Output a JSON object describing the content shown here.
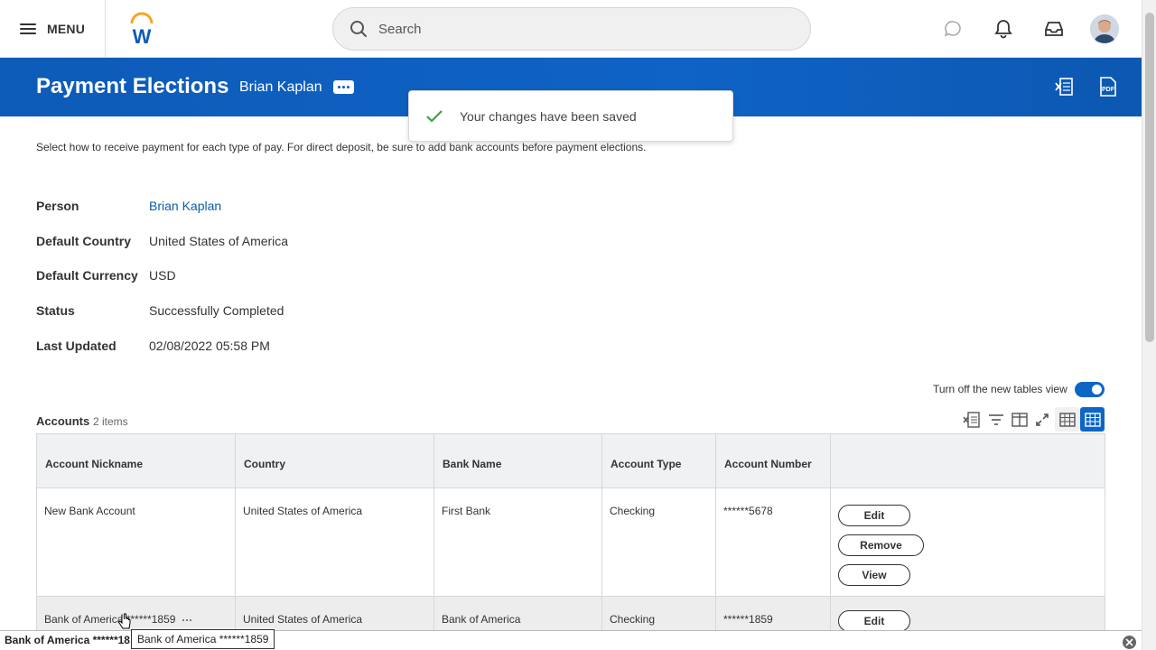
{
  "topbar": {
    "menu_label": "MENU",
    "search_placeholder": "Search"
  },
  "header": {
    "title": "Payment Elections",
    "worker": "Brian Kaplan"
  },
  "toast": {
    "message": "Your changes have been saved"
  },
  "instructions": "Select how to receive payment for each type of pay. For direct deposit, be sure to add bank accounts before payment elections.",
  "fields": {
    "person_label": "Person",
    "person_value": "Brian Kaplan",
    "country_label": "Default Country",
    "country_value": "United States of America",
    "currency_label": "Default Currency",
    "currency_value": "USD",
    "status_label": "Status",
    "status_value": "Successfully Completed",
    "updated_label": "Last Updated",
    "updated_value": "02/08/2022 05:58 PM"
  },
  "toggle": {
    "label": "Turn off the new tables view",
    "on": true
  },
  "accounts": {
    "title": "Accounts",
    "count": "2 items",
    "columns": [
      "Account Nickname",
      "Country",
      "Bank Name",
      "Account Type",
      "Account Number",
      ""
    ],
    "rows": [
      {
        "nickname": "New Bank Account",
        "country": "United States of America",
        "bank": "First Bank",
        "type": "Checking",
        "number": "******5678",
        "actions": [
          "Edit",
          "Remove",
          "View"
        ]
      },
      {
        "nickname": "Bank of America ******1859",
        "country": "United States of America",
        "bank": "Bank of America",
        "type": "Checking",
        "number": "******1859",
        "actions": [
          "Edit"
        ]
      }
    ]
  },
  "statusbar": {
    "text": "Bank of America ******18",
    "tooltip": "Bank of America ******1859"
  },
  "colors": {
    "brand_blue": "#0d5bb8",
    "success_green": "#43a047",
    "link": "#0b5ea8"
  }
}
